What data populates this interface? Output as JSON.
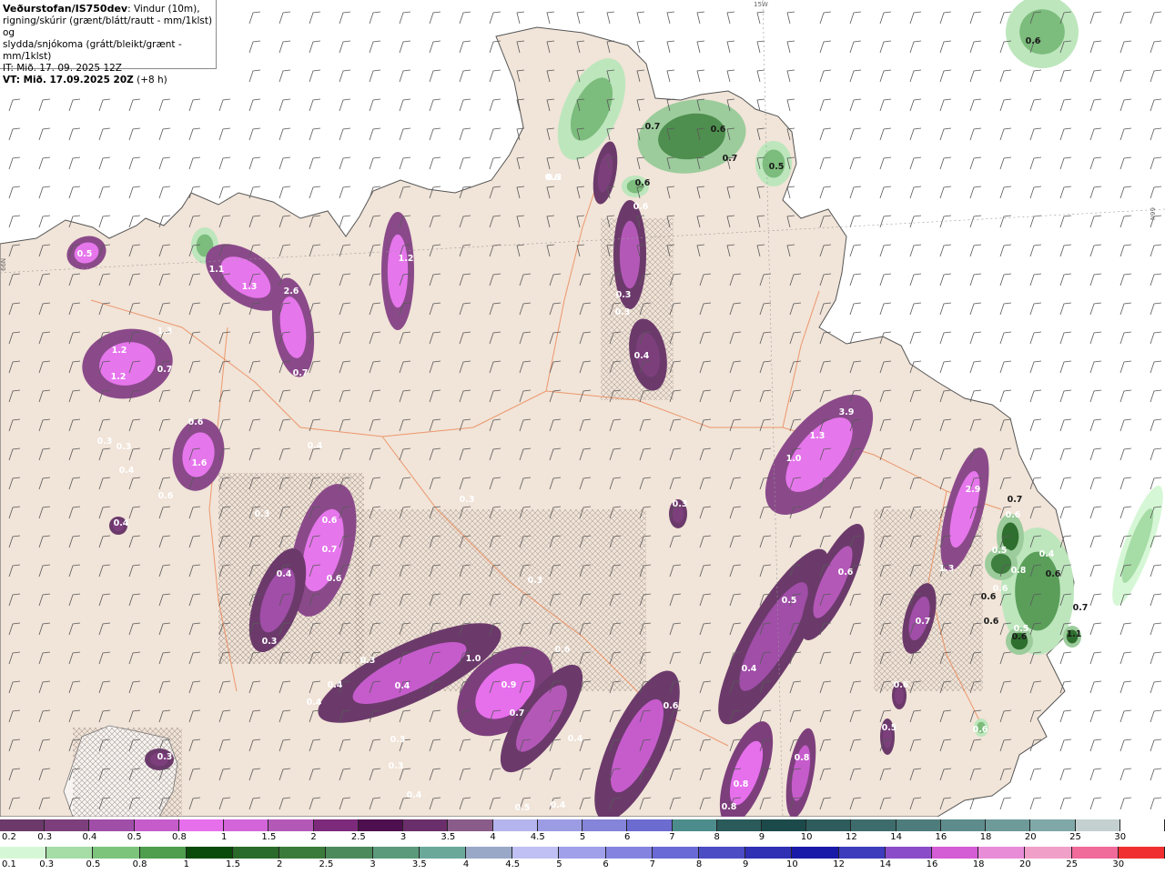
{
  "info": {
    "title": "Veðurstofan/IS750dev",
    "title_suffix": ": Vindur (10m),",
    "line2": "rigning/skúrir (grænt/blátt/rautt - mm/1klst) og",
    "line3": "slydda/snjókoma (grátt/bleikt/grænt - mm/1klst)",
    "line4": "IT: Mið. 17. 09. 2025 12Z",
    "line5_bold": "VT: Mið. 17.09.2025 20Z",
    "line5_rest": " (+8 h)"
  },
  "grid_labels": {
    "top": "15W",
    "left": "66N",
    "right": "66N"
  },
  "colors": {
    "land": "#f1e4d8",
    "sea": "#ffffff",
    "road": "#ec8a5a",
    "wind_barb": "#5a5a5a"
  },
  "precip_labels": [
    {
      "t": "0.5",
      "d": false
    },
    {
      "t": "1.1",
      "d": false
    },
    {
      "t": "1.3",
      "d": false
    },
    {
      "t": "2.6",
      "d": false
    },
    {
      "t": "0.7",
      "d": false
    },
    {
      "t": "1.2",
      "d": false
    },
    {
      "t": "1.2",
      "d": false
    },
    {
      "t": "1.3",
      "d": false
    },
    {
      "t": "1.2",
      "d": false
    },
    {
      "t": "0.7",
      "d": false
    },
    {
      "t": "0.6",
      "d": false
    },
    {
      "t": "1.6",
      "d": false
    },
    {
      "t": "0.3",
      "d": false
    },
    {
      "t": "0.3",
      "d": false
    },
    {
      "t": "0.4",
      "d": false
    },
    {
      "t": "0.6",
      "d": false
    },
    {
      "t": "0.4",
      "d": false
    },
    {
      "t": "0.6",
      "d": false
    },
    {
      "t": "0.7",
      "d": false
    },
    {
      "t": "0.6",
      "d": false
    },
    {
      "t": "0.3",
      "d": false
    },
    {
      "t": "0.4",
      "d": false
    },
    {
      "t": "0.3",
      "d": false
    },
    {
      "t": "0.3",
      "d": false
    },
    {
      "t": "0.4",
      "d": false
    },
    {
      "t": "0.4",
      "d": false
    },
    {
      "t": "0.4",
      "d": false
    },
    {
      "t": "1.0",
      "d": false
    },
    {
      "t": "0.9",
      "d": false
    },
    {
      "t": "0.7",
      "d": false
    },
    {
      "t": "0.6",
      "d": false
    },
    {
      "t": "0.3",
      "d": false
    },
    {
      "t": "0.6",
      "d": false
    },
    {
      "t": "0.3",
      "d": false
    },
    {
      "t": "0.4",
      "d": false
    },
    {
      "t": "0.3",
      "d": false
    },
    {
      "t": "0.4",
      "d": false
    },
    {
      "t": "0.5",
      "d": false
    },
    {
      "t": "0.4",
      "d": false
    },
    {
      "t": "0.8",
      "d": false
    },
    {
      "t": "0.8",
      "d": false
    },
    {
      "t": "0.8",
      "d": false
    },
    {
      "t": "0.6",
      "d": false
    },
    {
      "t": "0.3",
      "d": false
    },
    {
      "t": "0.3",
      "d": false
    },
    {
      "t": "0.6",
      "d": false
    },
    {
      "t": "0.3",
      "d": false
    },
    {
      "t": "0.3",
      "d": false
    },
    {
      "t": "0.4",
      "d": false
    },
    {
      "t": "3.9",
      "d": false
    },
    {
      "t": "1.3",
      "d": false
    },
    {
      "t": "1.0",
      "d": false
    },
    {
      "t": "0.3",
      "d": false
    },
    {
      "t": "0.4",
      "d": false
    },
    {
      "t": "0.6",
      "d": false
    },
    {
      "t": "0.5",
      "d": false
    },
    {
      "t": "0.4",
      "d": false
    },
    {
      "t": "2.9",
      "d": false
    },
    {
      "t": "1.3",
      "d": false
    },
    {
      "t": "0.7",
      "d": false
    },
    {
      "t": "0.5",
      "d": false
    },
    {
      "t": "0.6",
      "d": false
    },
    {
      "t": "0.7",
      "d": true
    },
    {
      "t": "0.6",
      "d": true
    },
    {
      "t": "0.7",
      "d": true
    },
    {
      "t": "0.5",
      "d": true
    },
    {
      "t": "0.6",
      "d": true
    },
    {
      "t": "0.6",
      "d": true
    },
    {
      "t": "0.7",
      "d": true
    },
    {
      "t": "0.6",
      "d": true
    },
    {
      "t": "0.6",
      "d": true
    },
    {
      "t": "0.6",
      "d": false
    },
    {
      "t": "0.3",
      "d": false
    },
    {
      "t": "0.6",
      "d": false
    },
    {
      "t": "0.8",
      "d": false
    },
    {
      "t": "0.6",
      "d": false
    },
    {
      "t": "0.7",
      "d": true
    },
    {
      "t": "0.6",
      "d": true
    },
    {
      "t": "0.5",
      "d": false
    },
    {
      "t": "1.1",
      "d": true
    },
    {
      "t": "0.6",
      "d": true
    },
    {
      "t": "0.5",
      "d": false
    },
    {
      "t": "0.4",
      "d": false
    }
  ],
  "legend_rain": {
    "labels": [
      "0.2",
      "0.3",
      "0.4",
      "0.5",
      "0.8",
      "1",
      "1.5",
      "2",
      "2.5",
      "3",
      "3.5",
      "4",
      "4.5",
      "5",
      "6",
      "7",
      "8",
      "9",
      "10",
      "12",
      "14",
      "16",
      "18",
      "20",
      "25",
      "30"
    ],
    "colors": [
      "#6b3a6b",
      "#7c3f7c",
      "#a04ea8",
      "#c65ccc",
      "#e66fec",
      "#d364d9",
      "#b458b8",
      "#7d2a7d",
      "#4d0f4d",
      "#6a2e6a",
      "#8a5c8a",
      "#b4b4ee",
      "#9c9ce4",
      "#8484da",
      "#6c6cd0",
      "#4c8c8c",
      "#2a5a5a",
      "#1c4a4a",
      "#2e5c5c",
      "#3e6c6c",
      "#4e7c7c",
      "#5e8c8c",
      "#6e9a9a",
      "#80a8a8",
      "#c4d0d0",
      "#ffffff"
    ]
  },
  "legend_snow": {
    "labels": [
      "0.1",
      "0.3",
      "0.5",
      "0.8",
      "1",
      "1.5",
      "2",
      "2.5",
      "3",
      "3.5",
      "4",
      "4.5",
      "5",
      "6",
      "7",
      "8",
      "9",
      "10",
      "12",
      "14",
      "16",
      "18",
      "20",
      "25",
      "30"
    ],
    "colors": [
      "#d6f7d6",
      "#a6dca6",
      "#7cc47c",
      "#4e9e4e",
      "#0a4a0a",
      "#2a6a2a",
      "#3a7a3a",
      "#4c8a5c",
      "#5c9a7c",
      "#6aa89a",
      "#9aa8c8",
      "#c0c0f4",
      "#a0a0ea",
      "#8484e0",
      "#6a6ad6",
      "#4c4cc4",
      "#3030b4",
      "#1a1aa8",
      "#3c3cbc",
      "#8a4cc8",
      "#d45cd4",
      "#e88cd8",
      "#f0a0c8",
      "#f06a9a",
      "#f03030"
    ]
  }
}
